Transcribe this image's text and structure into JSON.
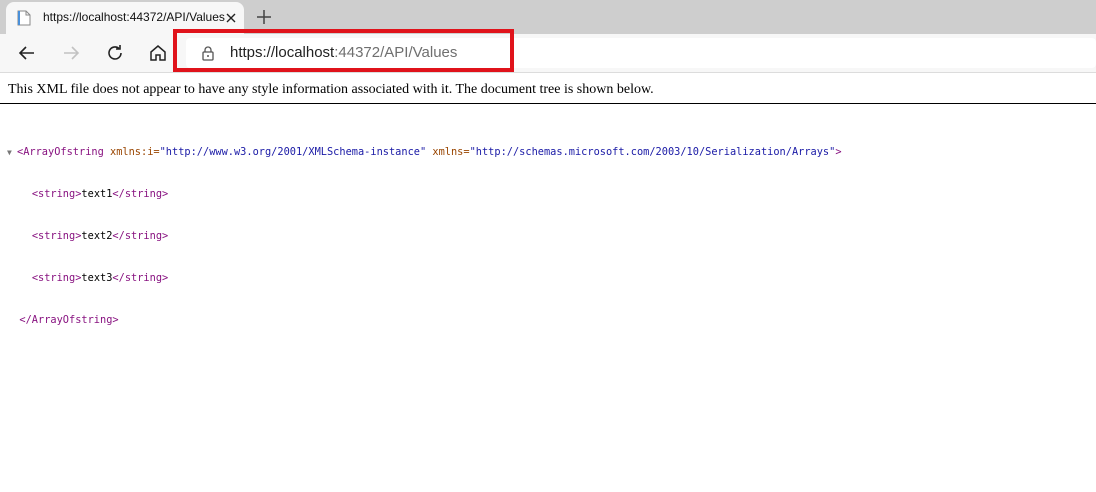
{
  "tab": {
    "title": "https://localhost:44372/API/Values"
  },
  "address": {
    "url_host": "https://localhost",
    "url_rest": ":44372/API/Values"
  },
  "xml_viewer": {
    "notice": "This XML file does not appear to have any style information associated with it. The document tree is shown below.",
    "root_open_tag": "<ArrayOfstring",
    "attr1_name": " xmlns:i=",
    "attr1_value": "\"http://www.w3.org/2001/XMLSchema-instance\"",
    "attr2_name": " xmlns=",
    "attr2_value": "\"http://schemas.microsoft.com/2003/10/Serialization/Arrays\"",
    "root_open_end": ">",
    "items": [
      {
        "open": "<string>",
        "text": "text1",
        "close": "</string>"
      },
      {
        "open": "<string>",
        "text": "text2",
        "close": "</string>"
      },
      {
        "open": "<string>",
        "text": "text3",
        "close": "</string>"
      }
    ],
    "root_close_tag": "</ArrayOfstring>"
  },
  "colors": {
    "highlight": "#e0131b",
    "tabstrip": "#cecece",
    "toolbar": "#f7f7f7"
  },
  "icons": [
    "file-icon",
    "close-icon",
    "plus-icon",
    "back-icon",
    "forward-icon",
    "refresh-icon",
    "home-icon",
    "lock-icon",
    "triangle-down-icon"
  ]
}
